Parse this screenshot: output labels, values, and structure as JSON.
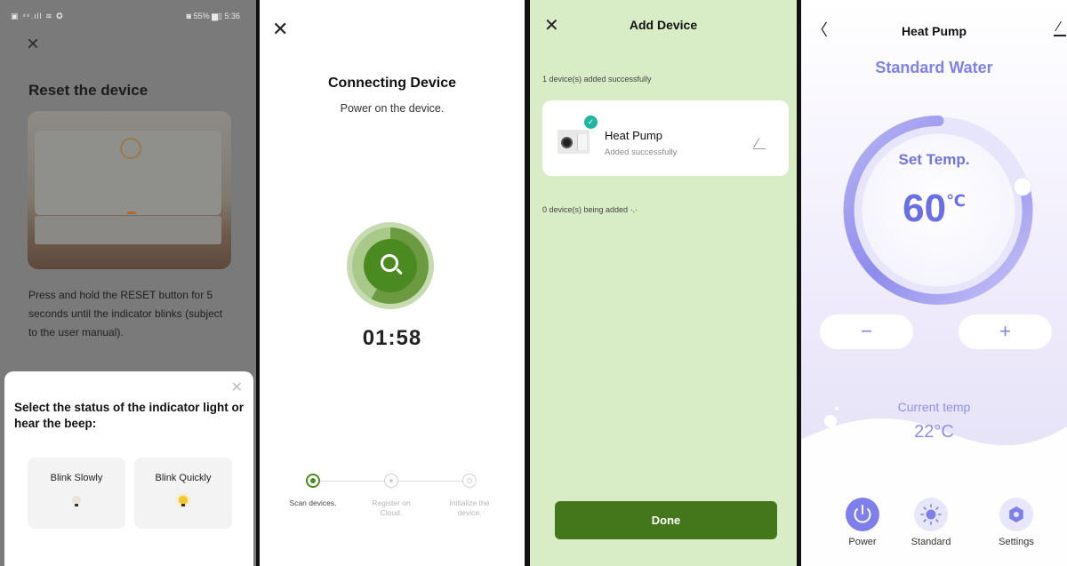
{
  "screen1": {
    "status_left": "▣ ⁴⁶.ıll ≋ ✪",
    "status_right": "◙ 55% ▆▯ 5:36",
    "heading": "Reset the device",
    "instructions": "Press and hold the RESET button for 5 seconds until the indicator blinks (subject to the user manual).",
    "sheet_title": "Select the status of the indicator light or hear the beep:",
    "options": [
      {
        "label": "Blink Slowly",
        "icon": "bulb-icon",
        "bulb_color": "#e9e4d6"
      },
      {
        "label": "Blink Quickly",
        "icon": "bulb-icon",
        "bulb_color": "#f6c52c"
      }
    ]
  },
  "screen2": {
    "title": "Connecting Device",
    "subtitle": "Power on the device.",
    "timer": "01:58",
    "accent": "#4a8a20",
    "steps": [
      {
        "label": "Scan devices.",
        "state": "active"
      },
      {
        "label": "Register on Cloud.",
        "state": "pending"
      },
      {
        "label": "Initialize the device.",
        "state": "pending"
      }
    ]
  },
  "screen3": {
    "title": "Add Device",
    "added_note": "1 device(s) added successfully",
    "device_name": "Heat Pump",
    "device_status": "Added successfully",
    "adding_note": "0 device(s) being added ·.·",
    "done_label": "Done",
    "background": "#d8ecc6",
    "button_color": "#44761c"
  },
  "screen4": {
    "title": "Heat Pump",
    "mode": "Standard Water",
    "set_label": "Set Temp.",
    "set_value": "60",
    "set_unit": "℃",
    "minus": "−",
    "plus": "+",
    "current_label": "Current temp",
    "current_value": "22°C",
    "accent": "#7f82e6",
    "nav": [
      {
        "label": "Power",
        "icon": "power-icon",
        "active": true
      },
      {
        "label": "Standard",
        "icon": "sun-icon",
        "active": false
      },
      {
        "label": "Settings",
        "icon": "gear-icon",
        "active": false
      }
    ]
  }
}
